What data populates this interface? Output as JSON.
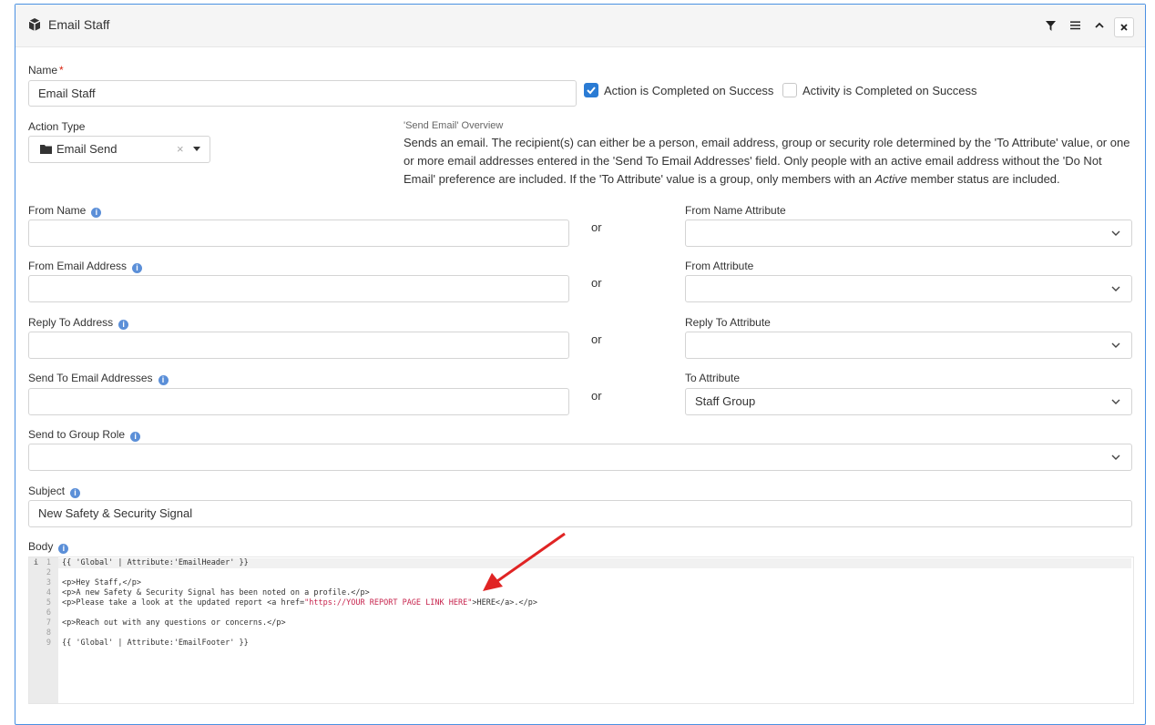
{
  "header": {
    "title": "Email Staff",
    "icon": "cube-icon",
    "actions": [
      "filter-icon",
      "menu-icon",
      "chevron-up-icon",
      "close-icon"
    ]
  },
  "name": {
    "label": "Name",
    "required_mark": "*",
    "value": "Email Staff",
    "action_completed_label": "Action is Completed on Success",
    "action_completed_checked": true,
    "activity_completed_label": "Activity is Completed on Success",
    "activity_completed_checked": false
  },
  "action_type": {
    "label": "Action Type",
    "value": "Email Send",
    "clear": "×"
  },
  "overview": {
    "title": "'Send Email' Overview",
    "text_before": "Sends an email. The recipient(s) can either be a person, email address, group or security role determined by the 'To Attribute' value, or one or more email addresses entered in the 'Send To Email Addresses' field. Only people with an active email address without the 'Do Not Email' preference are included. If the 'To Attribute' value is a group, only members with an ",
    "text_em": "Active",
    "text_after": " member status are included."
  },
  "or_label": "or",
  "from_name": {
    "label": "From Name",
    "value": ""
  },
  "from_name_attr": {
    "label": "From Name Attribute",
    "value": ""
  },
  "from_email": {
    "label": "From Email Address",
    "value": ""
  },
  "from_attr": {
    "label": "From Attribute",
    "value": ""
  },
  "reply_to": {
    "label": "Reply To Address",
    "value": ""
  },
  "reply_to_attr": {
    "label": "Reply To Attribute",
    "value": ""
  },
  "send_to": {
    "label": "Send To Email Addresses",
    "value": ""
  },
  "to_attr": {
    "label": "To Attribute",
    "value": "Staff Group"
  },
  "group_role": {
    "label": "Send to Group Role",
    "value": ""
  },
  "subject": {
    "label": "Subject",
    "value": "New Safety & Security Signal"
  },
  "body": {
    "label": "Body",
    "line_numbers": [
      "1",
      "2",
      "3",
      "4",
      "5",
      "6",
      "7",
      "8",
      "9"
    ],
    "lines": [
      "{{ 'Global' | Attribute:'EmailHeader' }}",
      "",
      "<p>Hey Staff,</p>",
      "<p>A new Safety & Security Signal has been noted on a profile.</p>",
      "",
      "",
      "<p>Reach out with any questions or concerns.</p>",
      "",
      "{{ 'Global' | Attribute:'EmailFooter' }}"
    ],
    "line5_before": "<p>Please take a look at the updated report <a href=",
    "line5_link": "\"https://YOUR REPORT PAGE LINK HERE\"",
    "line5_after": ">HERE</a>.</p>"
  },
  "colors": {
    "accent": "#2a7bd4",
    "arrow": "#e02424",
    "string": "#c7254e"
  }
}
